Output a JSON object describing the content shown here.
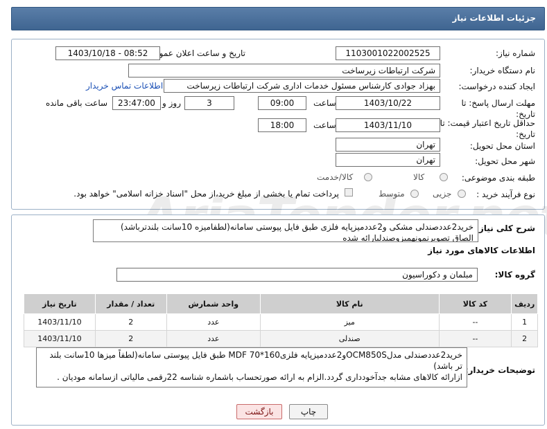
{
  "header": {
    "title": "جزئیات اطلاعات نیاز"
  },
  "need_number": {
    "label": "شماره نیاز:",
    "value": "1103001022002525"
  },
  "announce": {
    "label": "تاریخ و ساعت اعلان عمومی:",
    "value": "1403/10/18 - 08:52"
  },
  "buyer_org": {
    "label": "نام دستگاه خریدار:",
    "value": "شرکت ارتباطات زیرساخت"
  },
  "requester": {
    "label": "ایجاد کننده درخواست:",
    "value": "بهزاد جوادی کارشناس مسئول خدمات اداری شرکت ارتباطات زیرساخت",
    "contact_link": "اطلاعات تماس خریدار"
  },
  "reply_deadline": {
    "label": "مهلت ارسال پاسخ: تا تاریخ:",
    "date": "1403/10/22",
    "time_label": "ساعت",
    "time": "09:00",
    "days": "3",
    "days_label": "روز و",
    "remaining": "23:47:00",
    "remaining_label": "ساعت باقی مانده"
  },
  "price_validity": {
    "label": "حداقل تاریخ اعتبار قیمت: تا تاریخ:",
    "date": "1403/11/10",
    "time_label": "ساعت",
    "time": "18:00"
  },
  "province": {
    "label": "استان محل تحویل:",
    "value": "تهران"
  },
  "city": {
    "label": "شهر محل تحویل:",
    "value": "تهران"
  },
  "category": {
    "label": "طبقه بندی موضوعی:",
    "options": [
      "کالا",
      "کالا/خدمت"
    ]
  },
  "process": {
    "label": "نوع فرآیند خرید :",
    "options": [
      "جزیی",
      "متوسط"
    ],
    "payment_note": "پرداخت تمام یا بخشی از مبلغ خرید،از محل \"اسناد خزانه اسلامی\" خواهد بود."
  },
  "description": {
    "label": "شرح کلی نیاز:",
    "text": "خرید2عددصندلی مشکی و2عددمیزپایه فلزی طبق فایل پیوستی سامانه(لطفامیزه 10سانت بلندترباشد)\nالصاق تصویرنمونهمیزوصندلیارائه شده"
  },
  "goods_info": {
    "title": "اطلاعات کالاهای مورد نیاز"
  },
  "goods_group": {
    "label": "گروه کالا:",
    "value": "مبلمان و دکوراسیون"
  },
  "table": {
    "headers": [
      "ردیف",
      "کد کالا",
      "نام کالا",
      "واحد شمارش",
      "تعداد / مقدار",
      "تاریخ نیاز"
    ],
    "rows": [
      [
        "1",
        "--",
        "میز",
        "عدد",
        "2",
        "1403/11/10"
      ],
      [
        "2",
        "--",
        "صندلی",
        "عدد",
        "2",
        "1403/11/10"
      ]
    ]
  },
  "buyer_notes": {
    "label": "توضیحات خریدار:",
    "text": "خرید2عددصندلی مدلOCM850Sو2عددمیزپایه فلزی160*70 MDF طبق فایل پیوستی سامانه(لطفاً میزها 10سانت بلند تر باشد)\nازارائه کالاهای مشابه جدآخودداری گردد.الزام به ارائه صورتحساب باشماره شناسه 22رقمی مالیاتی ازسامانه مودیان ."
  },
  "buttons": {
    "print": "چاپ",
    "back": "بازگشت"
  },
  "watermark": "AriaTender.net"
}
